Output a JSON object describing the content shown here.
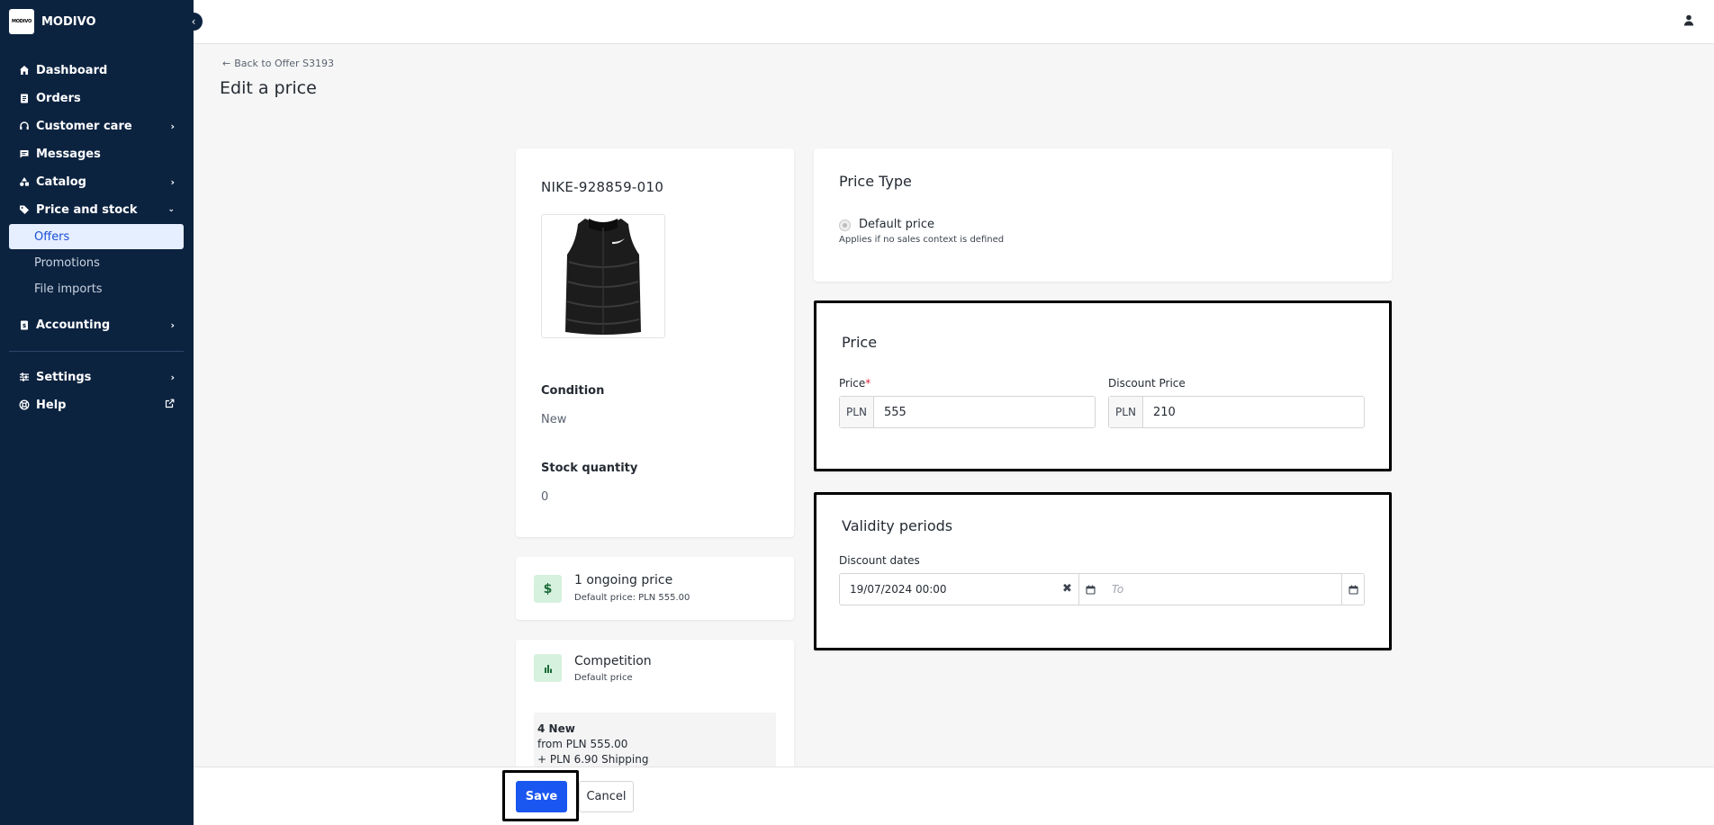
{
  "brand": {
    "logo_text": "MODIVO",
    "name": "MODIVO"
  },
  "sidebar": {
    "items": [
      {
        "label": "Dashboard",
        "icon": "home-icon"
      },
      {
        "label": "Orders",
        "icon": "clipboard-icon"
      },
      {
        "label": "Customer care",
        "icon": "headset-icon"
      },
      {
        "label": "Messages",
        "icon": "message-icon"
      },
      {
        "label": "Catalog",
        "icon": "shapes-icon"
      },
      {
        "label": "Price and stock",
        "icon": "tag-icon"
      },
      {
        "label": "Offers",
        "active": true
      },
      {
        "label": "Promotions"
      },
      {
        "label": "File imports"
      },
      {
        "label": "Accounting",
        "icon": "ledger-icon"
      },
      {
        "label": "Settings",
        "icon": "sliders-icon"
      },
      {
        "label": "Help",
        "icon": "lifebuoy-icon"
      }
    ]
  },
  "header": {
    "back_link": "Back to Offer S3193",
    "title": "Edit a price"
  },
  "product": {
    "sku": "NIKE-928859-010",
    "condition_label": "Condition",
    "condition_value": "New",
    "stock_label": "Stock quantity",
    "stock_value": "0"
  },
  "ongoing": {
    "title": "1 ongoing price",
    "subtitle": "Default price: PLN 555.00"
  },
  "competition": {
    "title": "Competition",
    "subtitle": "Default price",
    "line1": "4 New",
    "line2": "from PLN 555.00",
    "line3": "+ PLN 6.90 Shipping"
  },
  "price_type": {
    "title": "Price Type",
    "option_label": "Default price",
    "option_help": "Applies if no sales context is defined"
  },
  "price": {
    "title": "Price",
    "price_label": "Price",
    "required_mark": "*",
    "currency": "PLN",
    "price_value": "555",
    "discount_label": "Discount Price",
    "discount_value": "210"
  },
  "validity": {
    "title": "Validity periods",
    "dates_label": "Discount dates",
    "from_value": "19/07/2024 00:00",
    "to_placeholder": "To"
  },
  "footer": {
    "save_label": "Save",
    "cancel_label": "Cancel"
  },
  "colors": {
    "sidebar_bg": "#0c2340",
    "accent": "#1a56f0",
    "active_item_bg": "#e6efff",
    "badge_bg": "#d6f1de"
  }
}
